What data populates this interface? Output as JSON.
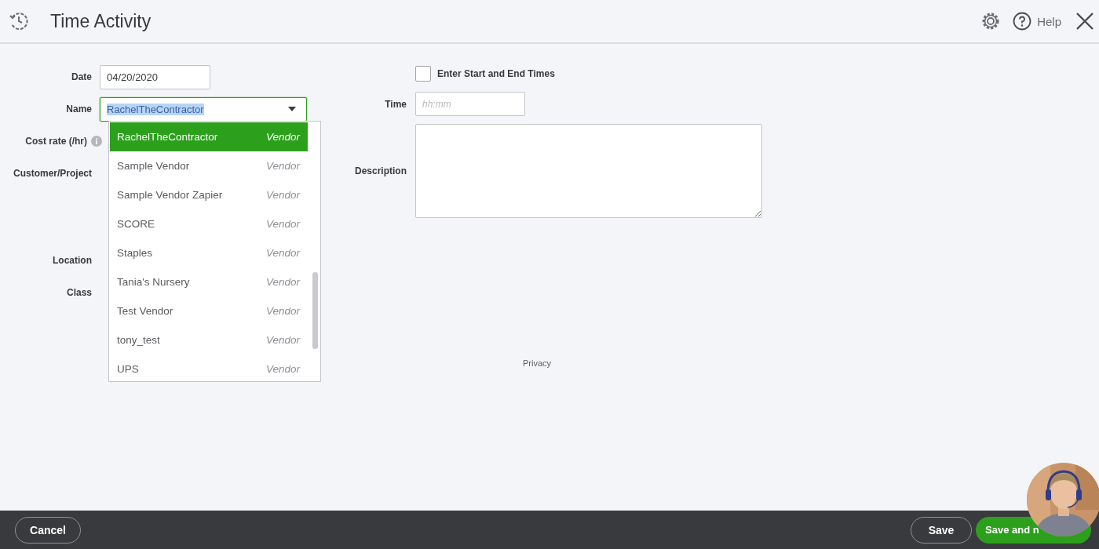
{
  "window": {
    "title": "Time Activity"
  },
  "header": {
    "help_label": "Help"
  },
  "left_fields": [
    {
      "kind": "input",
      "label": "Date",
      "value": "04/20/2020"
    },
    {
      "kind": "combo",
      "label": "Name",
      "value": "RachelTheContractor",
      "highlighted": true
    },
    {
      "kind": "info",
      "label": "Cost rate (/hr)"
    },
    {
      "kind": "plain",
      "label": "Customer/Project"
    },
    {
      "kind": "plain",
      "label": "Location"
    },
    {
      "kind": "plain",
      "label": "Class"
    }
  ],
  "dropdown": {
    "options": [
      {
        "name": "RachelTheContractor",
        "type": "Vendor",
        "selected": true
      },
      {
        "name": "Sample Vendor",
        "type": "Vendor",
        "selected": false
      },
      {
        "name": "Sample Vendor Zapier",
        "type": "Vendor",
        "selected": false
      },
      {
        "name": "SCORE",
        "type": "Vendor",
        "selected": false
      },
      {
        "name": "Staples",
        "type": "Vendor",
        "selected": false
      },
      {
        "name": "Tania's Nursery",
        "type": "Vendor",
        "selected": false
      },
      {
        "name": "Test Vendor",
        "type": "Vendor",
        "selected": false
      },
      {
        "name": "tony_test",
        "type": "Vendor",
        "selected": false
      },
      {
        "name": "UPS",
        "type": "Vendor",
        "selected": false
      }
    ]
  },
  "start_end_checkbox": {
    "label": "Enter Start and End Times",
    "checked": false
  },
  "time": {
    "label": "Time",
    "placeholder": "hh:mm"
  },
  "description": {
    "label": "Description"
  },
  "privacy_link": "Privacy",
  "footer": {
    "cancel": "Cancel",
    "save": "Save",
    "save_and_new": "Save and n"
  }
}
